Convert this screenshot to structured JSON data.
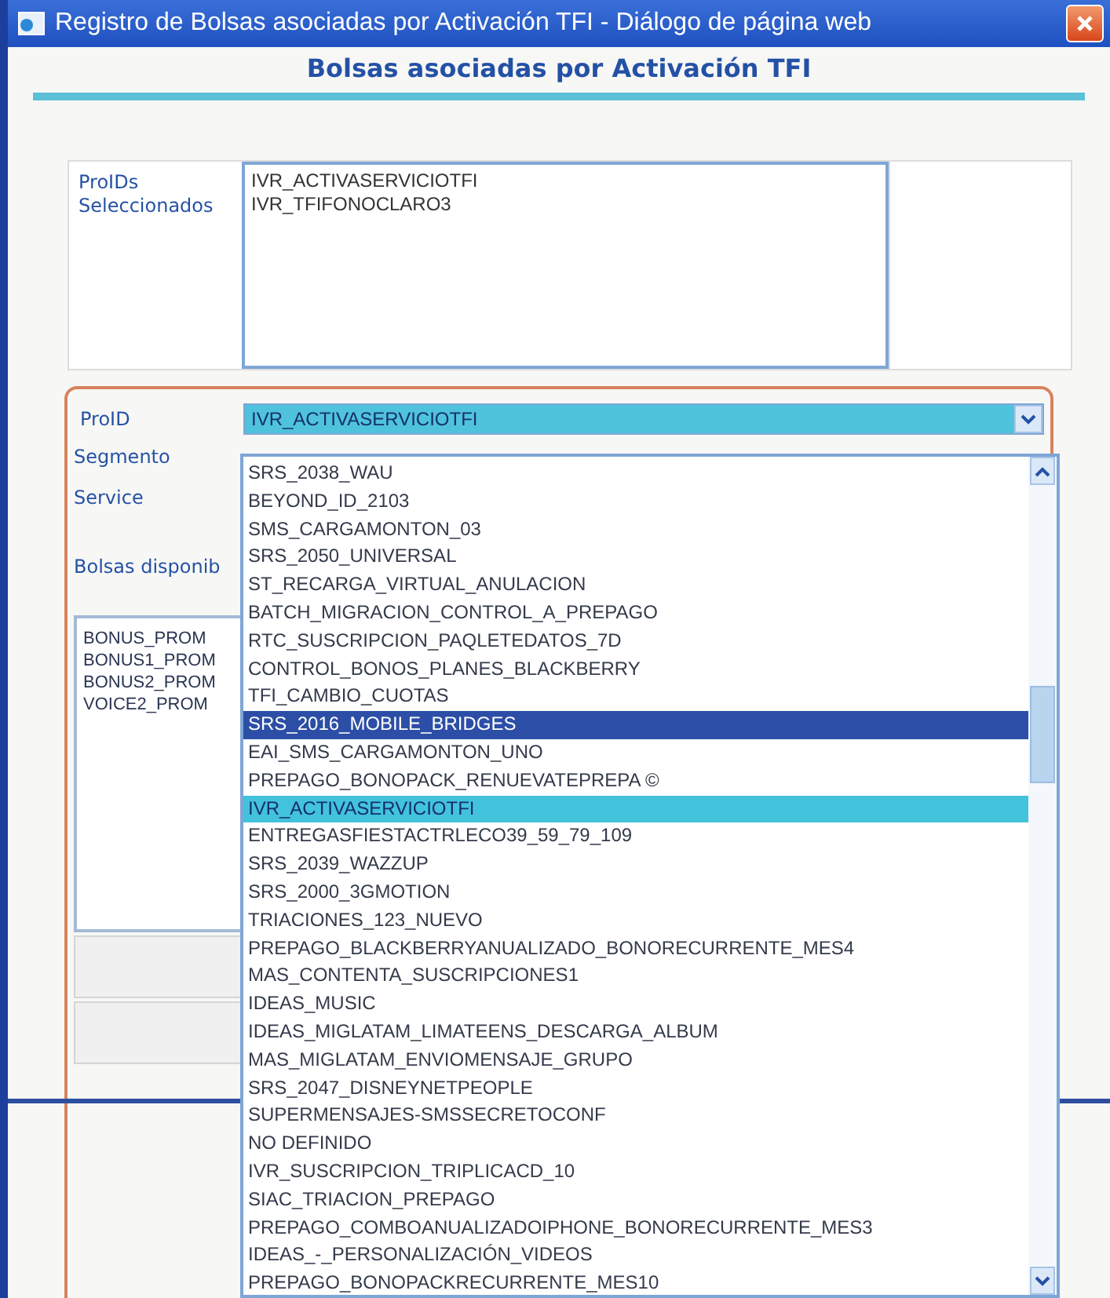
{
  "window": {
    "title": "Registro de Bolsas asociadas por Activación TFI - Diálogo de página web"
  },
  "header": {
    "title": "Bolsas asociadas por Activación TFI"
  },
  "selected_proids": {
    "label": "ProIDs Seleccionados",
    "items": [
      "IVR_ACTIVASERVICIOTFI",
      "IVR_TFIFONOCLARO3"
    ]
  },
  "form": {
    "proid": {
      "label": "ProID",
      "value": "IVR_ACTIVASERVICIOTFI"
    },
    "labels": [
      "Segmento",
      "Service"
    ],
    "bolsas_label": "Bolsas disponib",
    "bolsas": [
      "BONUS_PROM",
      "BONUS1_PROM",
      "BONUS2_PROM",
      "VOICE2_PROM"
    ]
  },
  "dropdown": {
    "options": [
      {
        "label": "SRS_2038_WAU",
        "selected": false,
        "highlighted": false
      },
      {
        "label": "BEYOND_ID_2103",
        "selected": false,
        "highlighted": false
      },
      {
        "label": "SMS_CARGAMONTON_03",
        "selected": false,
        "highlighted": false
      },
      {
        "label": "SRS_2050_UNIVERSAL",
        "selected": false,
        "highlighted": false
      },
      {
        "label": "ST_RECARGA_VIRTUAL_ANULACION",
        "selected": false,
        "highlighted": false
      },
      {
        "label": "BATCH_MIGRACION_CONTROL_A_PREPAGO",
        "selected": false,
        "highlighted": false
      },
      {
        "label": "RTC_SUSCRIPCION_PAQLETEDATOS_7D",
        "selected": false,
        "highlighted": false
      },
      {
        "label": "CONTROL_BONOS_PLANES_BLACKBERRY",
        "selected": false,
        "highlighted": false
      },
      {
        "label": "TFI_CAMBIO_CUOTAS",
        "selected": false,
        "highlighted": false
      },
      {
        "label": "SRS_2016_MOBILE_BRIDGES",
        "selected": true,
        "highlighted": false
      },
      {
        "label": "EAI_SMS_CARGAMONTON_UNO",
        "selected": false,
        "highlighted": false
      },
      {
        "label": "PREPAGO_BONOPACK_RENUEVATEPREPA ©",
        "selected": false,
        "highlighted": false
      },
      {
        "label": "IVR_ACTIVASERVICIOTFI",
        "selected": false,
        "highlighted": true
      },
      {
        "label": "ENTREGASFIESTACTRLECO39_59_79_109",
        "selected": false,
        "highlighted": false
      },
      {
        "label": "SRS_2039_WAZZUP",
        "selected": false,
        "highlighted": false
      },
      {
        "label": "SRS_2000_3GMOTION",
        "selected": false,
        "highlighted": false
      },
      {
        "label": "TRIACIONES_123_NUEVO",
        "selected": false,
        "highlighted": false
      },
      {
        "label": "PREPAGO_BLACKBERRYANUALIZADO_BONORECURRENTE_MES4",
        "selected": false,
        "highlighted": false
      },
      {
        "label": "MAS_CONTENTA_SUSCRIPCIONES1",
        "selected": false,
        "highlighted": false
      },
      {
        "label": "IDEAS_MUSIC",
        "selected": false,
        "highlighted": false
      },
      {
        "label": "IDEAS_MIGLATAM_LIMATEENS_DESCARGA_ALBUM",
        "selected": false,
        "highlighted": false
      },
      {
        "label": "MAS_MIGLATAM_ENVIOMENSAJE_GRUPO",
        "selected": false,
        "highlighted": false
      },
      {
        "label": "SRS_2047_DISNEYNETPEOPLE",
        "selected": false,
        "highlighted": false
      },
      {
        "label": "SUPERMENSAJES-SMSSECRETOCONF",
        "selected": false,
        "highlighted": false
      },
      {
        "label": "NO DEFINIDO",
        "selected": false,
        "highlighted": false
      },
      {
        "label": "IVR_SUSCRIPCION_TRIPLICACD_10",
        "selected": false,
        "highlighted": false
      },
      {
        "label": "SIAC_TRIACION_PREPAGO",
        "selected": false,
        "highlighted": false
      },
      {
        "label": "PREPAGO_COMBOANUALIZADOIPHONE_BONORECURRENTE_MES3",
        "selected": false,
        "highlighted": false
      },
      {
        "label": "IDEAS_-_PERSONALIZACIÓN_VIDEOS",
        "selected": false,
        "highlighted": false
      },
      {
        "label": "PREPAGO_BONOPACKRECURRENTE_MES10",
        "selected": false,
        "highlighted": false
      }
    ]
  }
}
